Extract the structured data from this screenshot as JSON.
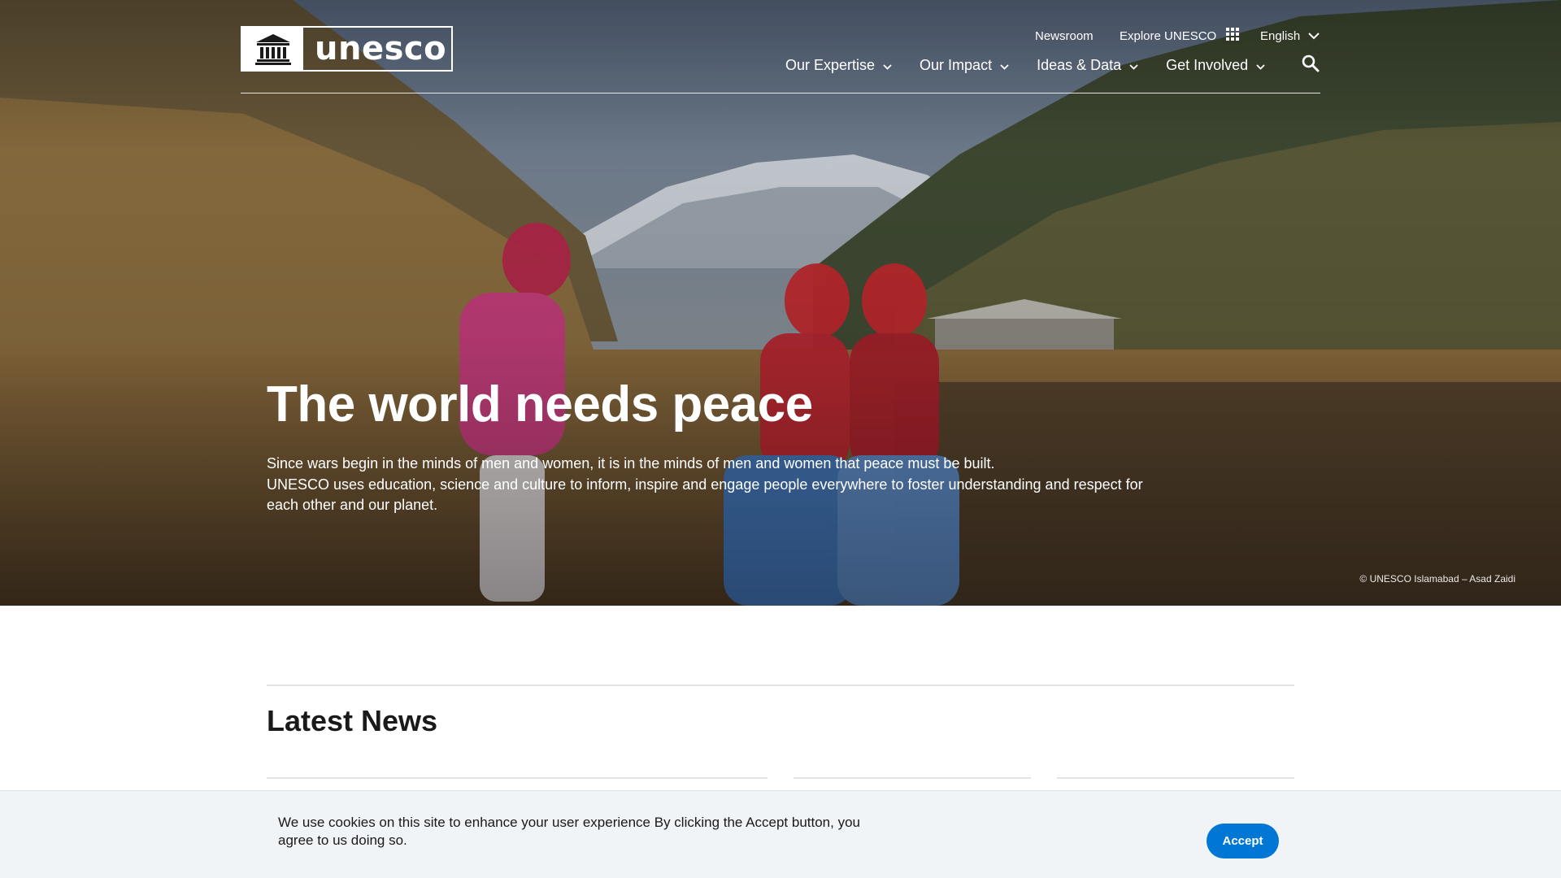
{
  "header": {
    "logo_text": "unesco",
    "util_nav": {
      "newsroom": "Newsroom",
      "explore": "Explore UNESCO",
      "language": "English"
    },
    "main_nav": [
      {
        "label": "Our Expertise"
      },
      {
        "label": "Our Impact"
      },
      {
        "label": "Ideas & Data"
      },
      {
        "label": "Get Involved"
      }
    ],
    "icons": {
      "emblem": "unesco-temple-emblem",
      "grid": "apps-grid-icon",
      "chevron": "chevron-down-icon",
      "search": "search-icon"
    }
  },
  "hero": {
    "title": "The world needs peace",
    "description_line1": "Since wars begin in the minds of men and women, it is in the minds of men and women that peace must be built.",
    "description_line2": "UNESCO uses education, science and culture to inform, inspire and engage people everywhere to foster understanding and respect for each other and our planet.",
    "photo_credit": "© UNESCO Islamabad – Asad Zaidi"
  },
  "latest_news": {
    "title": "Latest News"
  },
  "cookie_banner": {
    "message": "We use cookies on this site to enhance your user experience  By clicking the Accept button, you agree to us doing so.",
    "accept_label": "Accept"
  },
  "colors": {
    "accent_button": "#0077d4",
    "cookie_background": "#f1f4f7",
    "text_dark": "#1a1a1a"
  }
}
